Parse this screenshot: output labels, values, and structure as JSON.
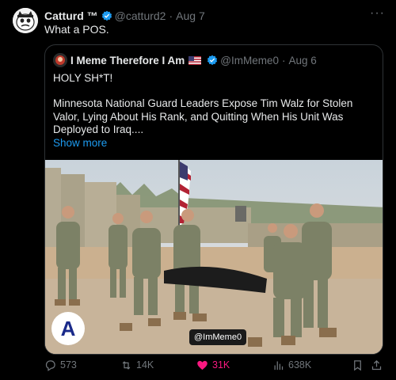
{
  "tweet": {
    "author_name": "Catturd ™",
    "handle": "@catturd2",
    "separator": "·",
    "date": "Aug 7",
    "more": "···",
    "text": "What a POS."
  },
  "quote": {
    "author_name": "I Meme Therefore I Am",
    "handle": "@ImMeme0",
    "separator": "·",
    "date": "Aug 6",
    "line1": "HOLY SH*T!",
    "body": "Minnesota National Guard Leaders Expose Tim Walz for Stolen Valor, Lying About His Rank, and Quitting When His Unit Was Deployed to Iraq....",
    "show_more": "Show more",
    "image_watermark": "@ImMeme0",
    "image_logo_letter": "A"
  },
  "actions": {
    "replies": "573",
    "reposts": "14K",
    "likes": "31K",
    "views": "638K"
  },
  "colors": {
    "background": "#000000",
    "border": "#2f3336",
    "muted": "#71767b",
    "link": "#1d9bf0",
    "like": "#f91880",
    "verified": "#1d9bf0"
  },
  "icons": [
    "verified-badge-icon",
    "us-flag-icon",
    "more-icon",
    "reply-icon",
    "repost-icon",
    "heart-icon",
    "views-icon",
    "bookmark-icon",
    "share-icon"
  ]
}
